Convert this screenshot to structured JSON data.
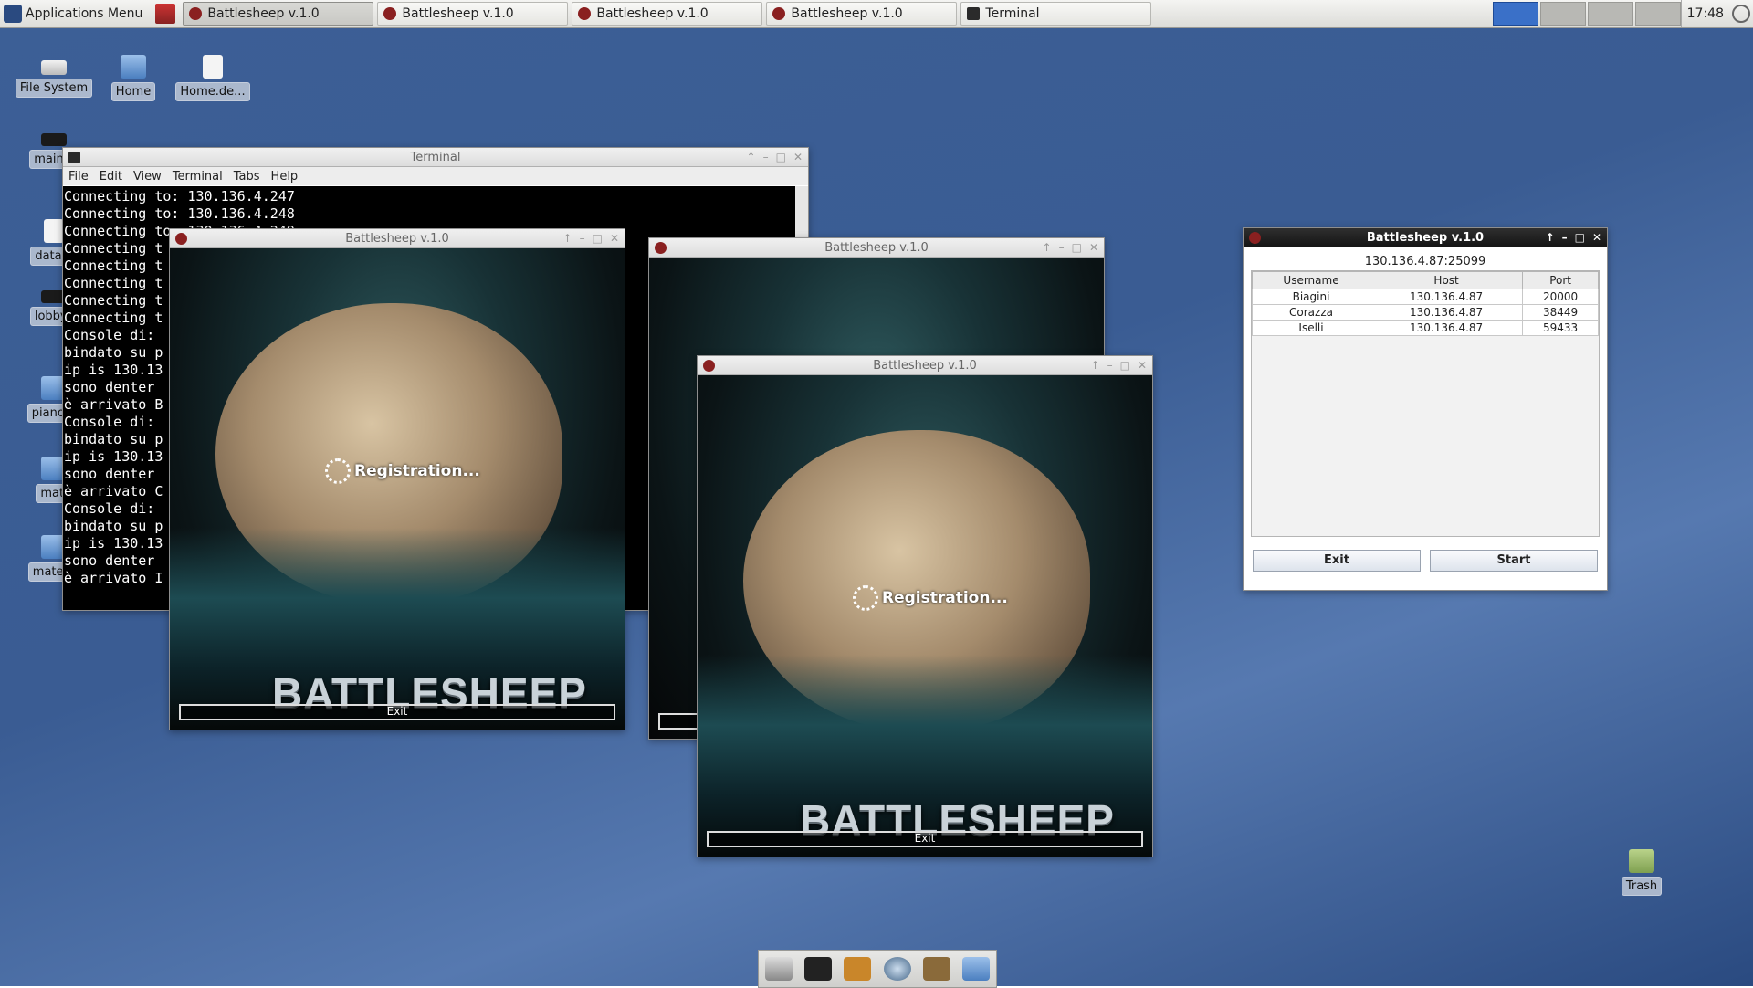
{
  "panel": {
    "app_menu": "Applications Menu",
    "tasks": [
      {
        "label": "Battlesheep v.1.0",
        "active": true
      },
      {
        "label": "Battlesheep v.1.0",
        "active": false
      },
      {
        "label": "Battlesheep v.1.0",
        "active": false
      },
      {
        "label": "Battlesheep v.1.0",
        "active": false
      },
      {
        "label": "Terminal",
        "active": false
      }
    ],
    "clock": "17:48"
  },
  "desktop_icons": [
    {
      "label": "File System",
      "icon": "drive-icon"
    },
    {
      "label": "Home",
      "icon": "home-folder-icon"
    },
    {
      "label": "Home.de...",
      "icon": "document-icon"
    },
    {
      "label": "main_f",
      "icon": "executable-icon"
    },
    {
      "label": "data o",
      "icon": "document-icon"
    },
    {
      "label": "lobby_",
      "icon": "executable-icon"
    },
    {
      "label": "piano d",
      "icon": "folder-icon"
    },
    {
      "label": "mati",
      "icon": "folder-icon"
    },
    {
      "label": "matem",
      "icon": "folder-icon"
    },
    {
      "label": "Trash",
      "icon": "trash-icon"
    }
  ],
  "terminal": {
    "title": "Terminal",
    "menu": [
      "File",
      "Edit",
      "View",
      "Terminal",
      "Tabs",
      "Help"
    ],
    "lines": [
      "Connecting to: 130.136.4.247",
      "Connecting to: 130.136.4.248",
      "Connecting to: 130.136.4.249",
      "Connecting t",
      "Connecting t",
      "Connecting t",
      "Connecting t",
      "Connecting t",
      "Console di:",
      "bindato su p",
      "ip is 130.13",
      "sono denter",
      "è arrivato B",
      "Console di:",
      "bindato su p",
      "ip is 130.13",
      "sono denter",
      "è arrivato C",
      "Console di:",
      "bindato su p",
      "ip is 130.13",
      "sono denter",
      "è arrivato I"
    ]
  },
  "game_windows": {
    "title": "Battlesheep v.1.0",
    "status": "Registration...",
    "logo": "BATTLESHEEP",
    "exit_label": "Exit"
  },
  "lobby": {
    "title": "Battlesheep v.1.0",
    "address": "130.136.4.87:25099",
    "columns": [
      "Username",
      "Host",
      "Port"
    ],
    "rows": [
      {
        "username": "Biagini",
        "host": "130.136.4.87",
        "port": "20000"
      },
      {
        "username": "Corazza",
        "host": "130.136.4.87",
        "port": "38449"
      },
      {
        "username": "Iselli",
        "host": "130.136.4.87",
        "port": "59433"
      }
    ],
    "exit_button": "Exit",
    "start_button": "Start"
  },
  "dock": [
    "drive-icon",
    "terminal-icon",
    "archive-icon",
    "globe-icon",
    "search-tool-icon",
    "folder-icon"
  ]
}
